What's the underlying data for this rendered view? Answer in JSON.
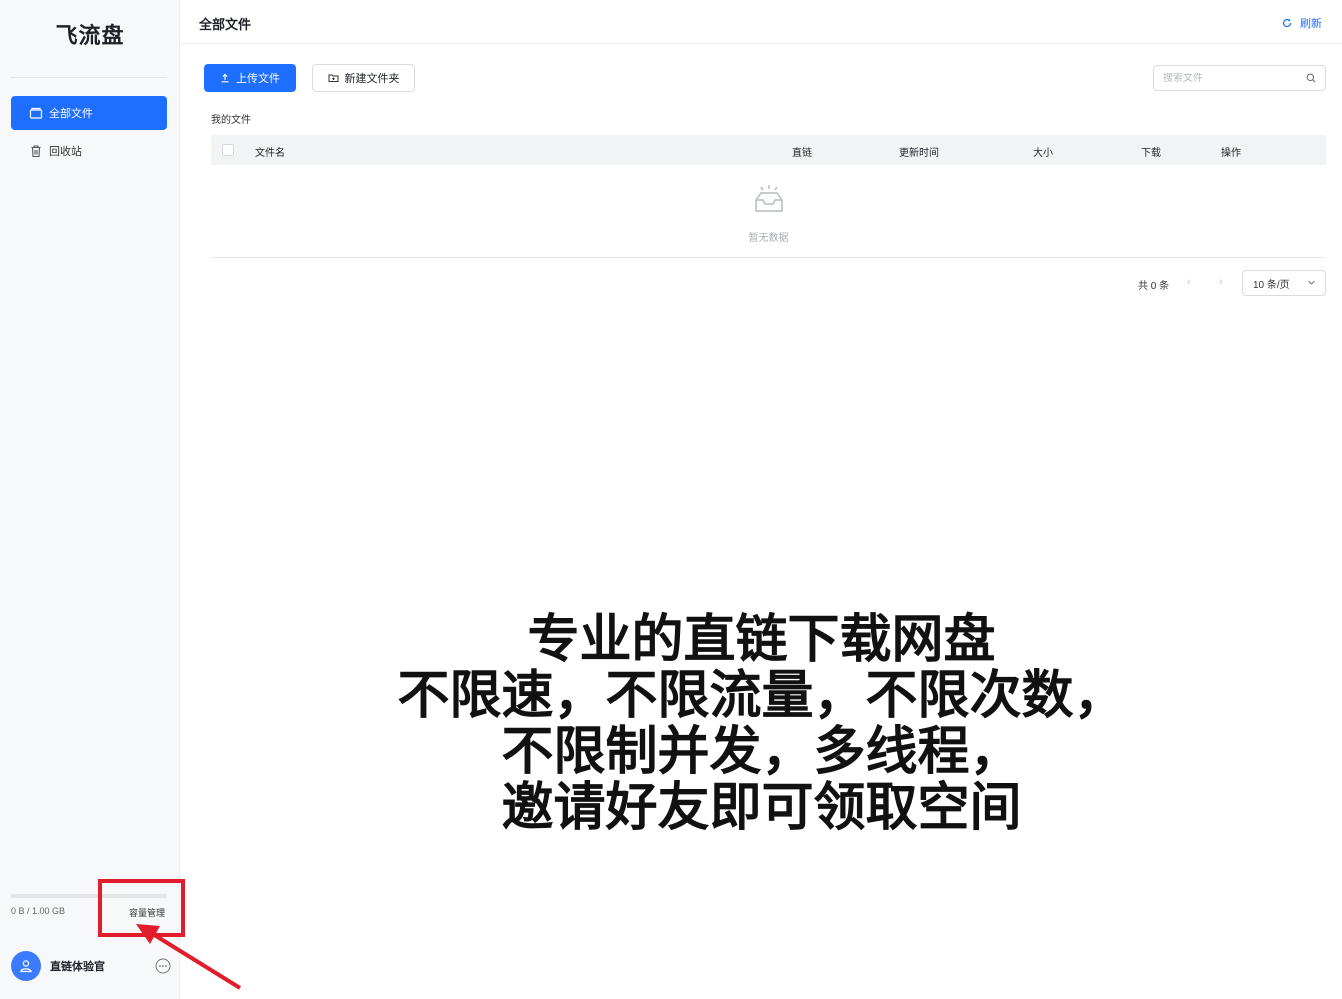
{
  "app": {
    "name": "飞流盘"
  },
  "sidebar": {
    "items": [
      {
        "label": "全部文件",
        "icon": "folder-icon",
        "active": true
      },
      {
        "label": "回收站",
        "icon": "trash-icon",
        "active": false
      }
    ],
    "storage": {
      "used_text": "0 B / 1.00 GB",
      "used_fraction": 0,
      "manage_label": "容量管理"
    },
    "user": {
      "name": "直链体验官",
      "avatar_icon": "user-icon",
      "more_icon": "more-icon"
    }
  },
  "header": {
    "title": "全部文件",
    "refresh_label": "刷新",
    "refresh_icon": "refresh-icon"
  },
  "toolbar": {
    "upload_label": "上传文件",
    "new_folder_label": "新建文件夹",
    "search_placeholder": "搜索文件"
  },
  "breadcrumb": "我的文件",
  "table": {
    "columns": [
      "文件名",
      "直链",
      "更新时间",
      "大小",
      "下载",
      "操作"
    ],
    "rows": [],
    "empty_text": "暂无数据"
  },
  "pagination": {
    "total_text": "共 0 条",
    "page_size": "10 条/页"
  },
  "caption": {
    "lines": [
      "专业的直链下载网盘",
      "不限速，不限流量，不限次数，",
      "不限制并发，多线程，",
      "邀请好友即可领取空间"
    ]
  },
  "colors": {
    "primary": "#1e6fff",
    "annotation": "#e11d2b",
    "sidebar_bg": "#f7f8fa"
  }
}
